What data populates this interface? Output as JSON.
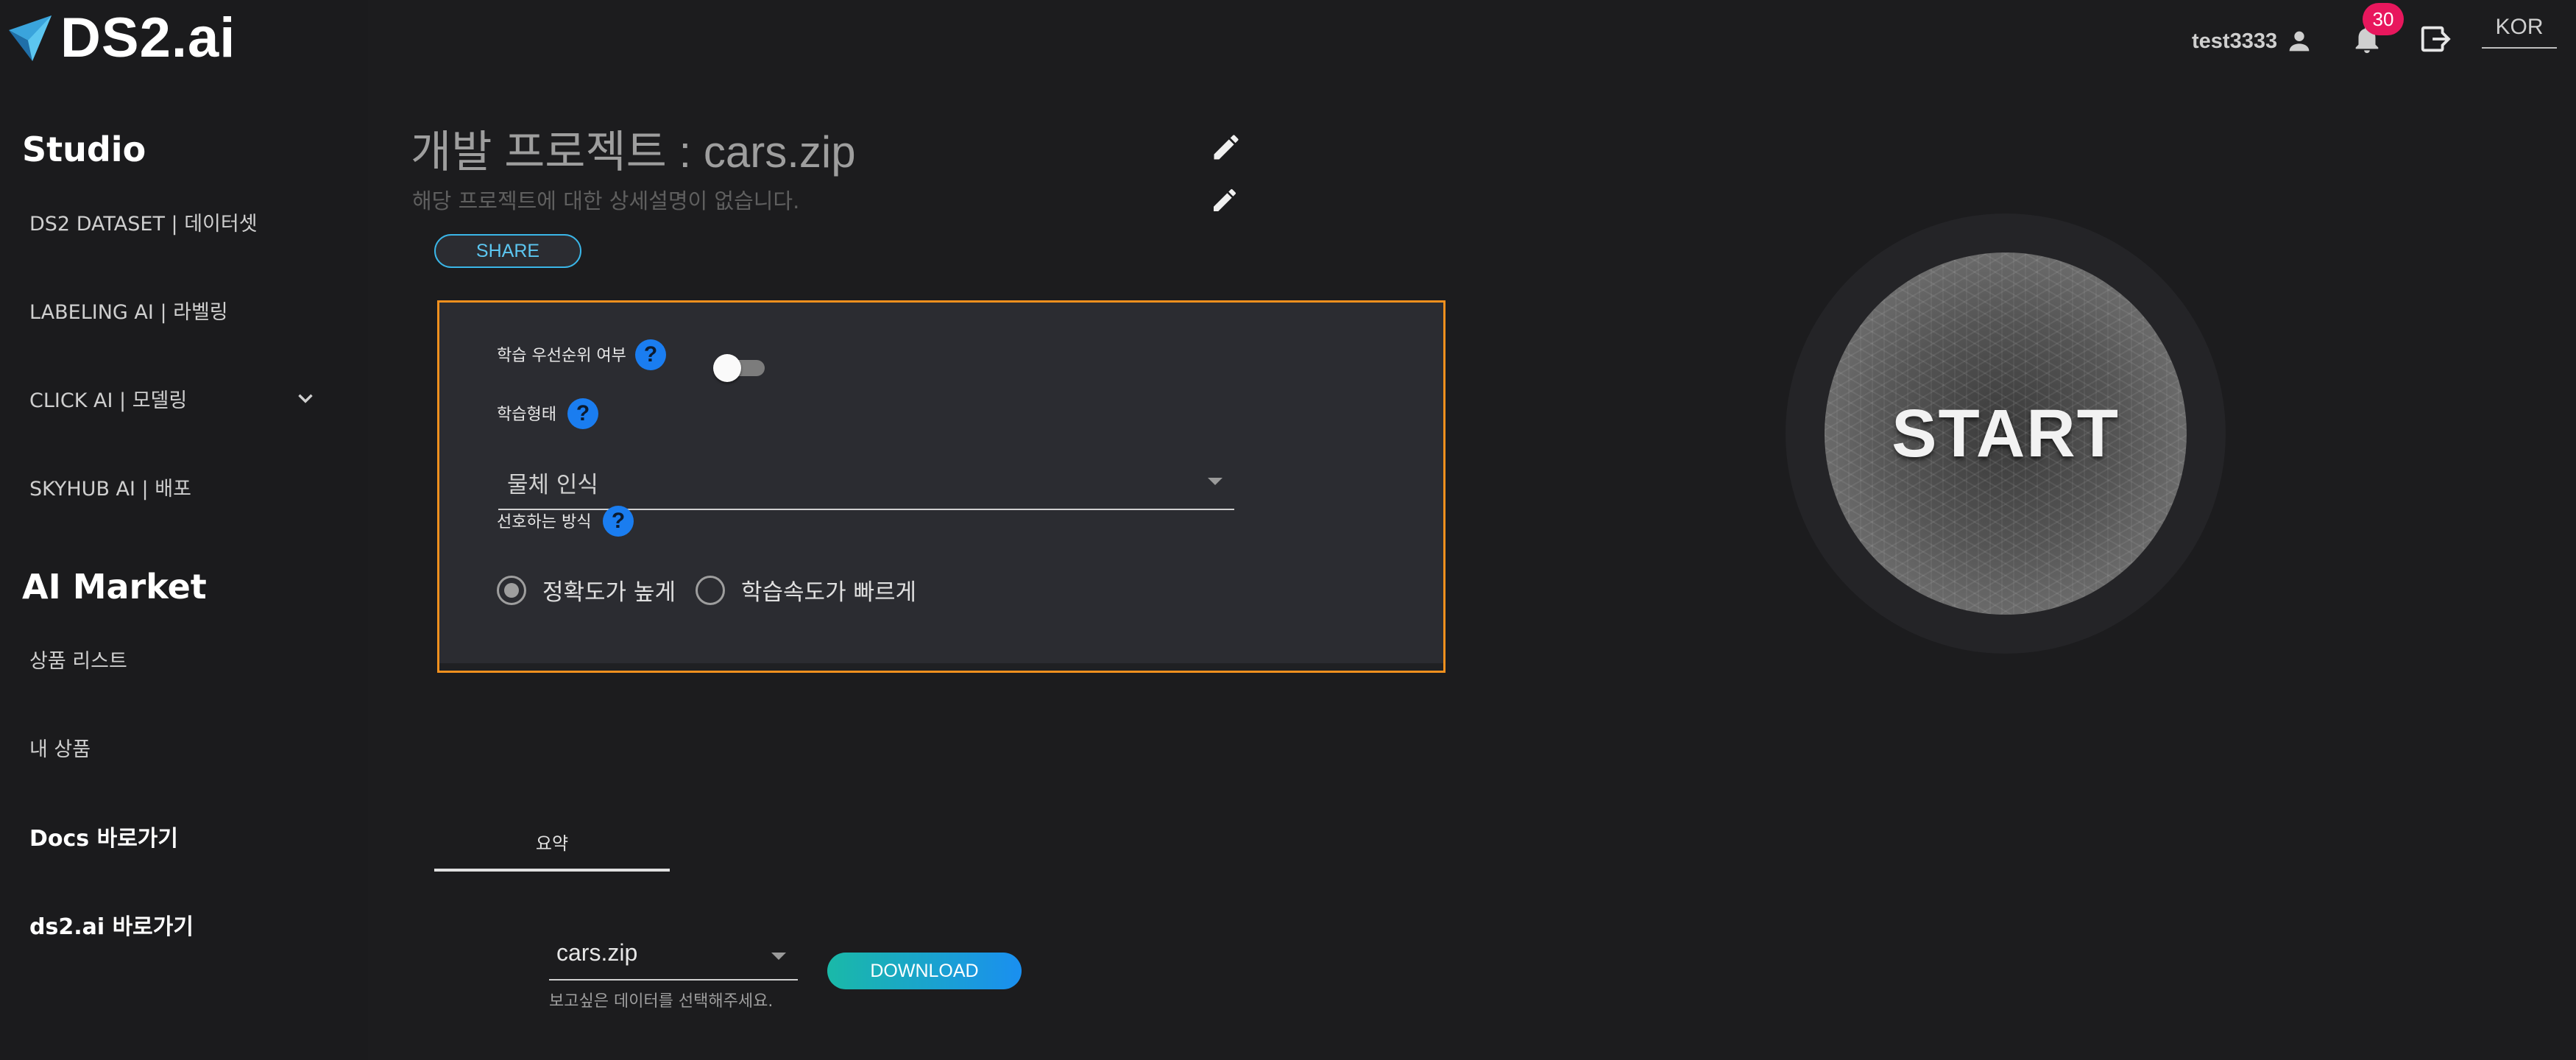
{
  "app": {
    "logo_text": "DS2.ai"
  },
  "sidebar": {
    "studio_heading": "Studio",
    "studio_items": [
      {
        "label": "DS2 DATASET | 데이터셋"
      },
      {
        "label": "LABELING AI | 라벨링"
      },
      {
        "label": "CLICK AI | 모델링"
      },
      {
        "label": "SKYHUB AI | 배포"
      }
    ],
    "market_heading": "AI Market",
    "market_items": [
      {
        "label": "상품 리스트"
      },
      {
        "label": "내 상품"
      }
    ],
    "links": [
      {
        "label": "Docs 바로가기"
      },
      {
        "label": "ds2.ai 바로가기"
      }
    ]
  },
  "topbar": {
    "username": "test3333",
    "notification_count": "30",
    "language": "KOR"
  },
  "project": {
    "title": "개발 프로젝트 : cars.zip",
    "description": "해당 프로젝트에 대한 상세설명이 없습니다.",
    "share_label": "SHARE"
  },
  "settings": {
    "priority_label": "학습 우선순위 여부",
    "priority_enabled": false,
    "training_type_label": "학습형태",
    "training_type_value": "물체 인식",
    "preference_label": "선호하는 방식",
    "preference_options": [
      {
        "label": "정확도가 높게",
        "selected": true
      },
      {
        "label": "학습속도가 빠르게",
        "selected": false
      }
    ],
    "help_glyph": "?"
  },
  "start": {
    "label": "START"
  },
  "summary": {
    "tab_label": "요약",
    "data_select_value": "cars.zip",
    "data_select_hint": "보고싶은 데이터를 선택해주세요.",
    "download_label": "DOWNLOAD"
  },
  "colors": {
    "panel_border": "#f0901e",
    "help_blue": "#1a7df0",
    "share_border": "#3ab6e8",
    "badge": "#e8175d",
    "download_gradient_start": "#1ab9a8",
    "download_gradient_end": "#1a8ff0"
  },
  "icons": {
    "logo": "ds2-logo-icon",
    "user": "person-icon",
    "notifications": "bell-icon",
    "logout": "logout-icon",
    "edit": "pencil-icon",
    "expand": "chevron-down-icon"
  }
}
